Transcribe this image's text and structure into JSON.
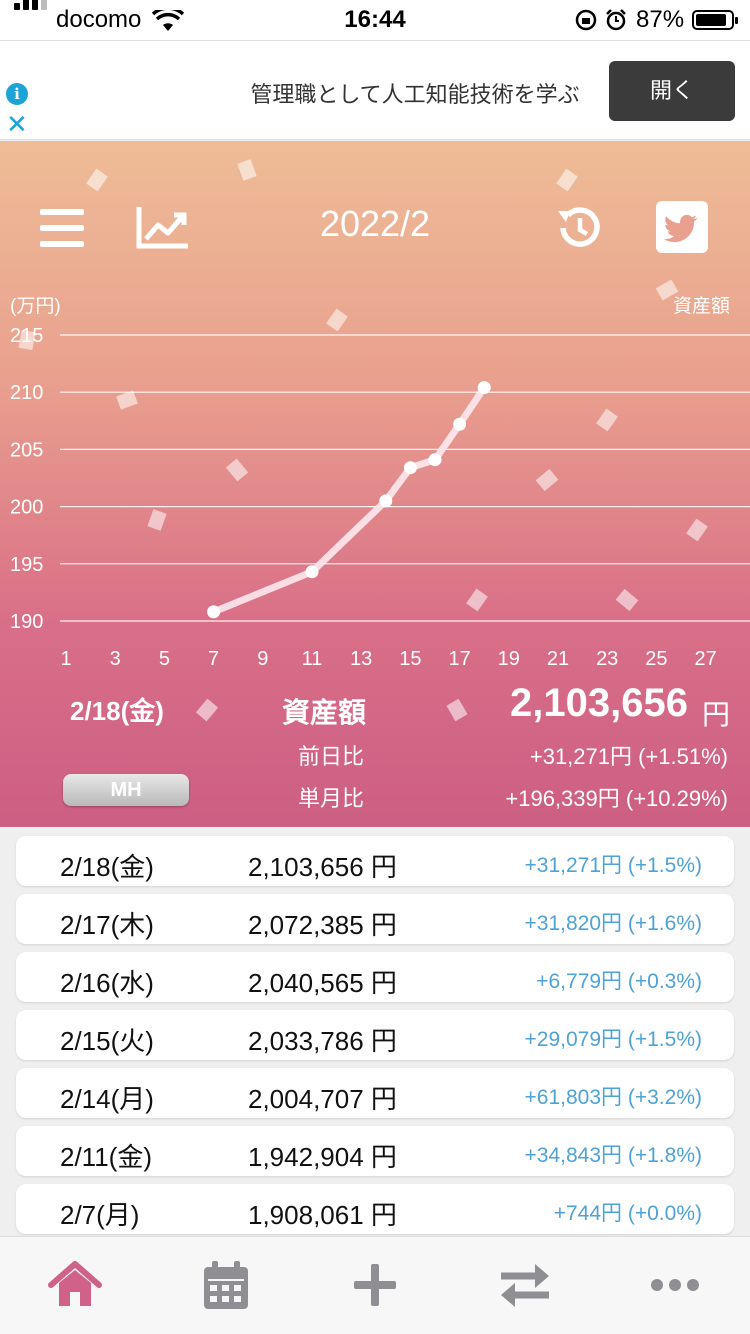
{
  "status_bar": {
    "carrier": "docomo",
    "time": "16:44",
    "battery": "87%"
  },
  "ad": {
    "text": "管理職として人工知能技術を学ぶ",
    "button": "開く"
  },
  "header": {
    "title": "2022/2",
    "y_unit": "(万円)",
    "series_label": "資産額",
    "selected_date": "2/18(金)",
    "asset_label": "資産額",
    "asset_value": "2,103,656",
    "asset_unit": "円",
    "prev_day_label": "前日比",
    "prev_day_value": "+31,271円 (+1.51%)",
    "month_label": "単月比",
    "month_value": "+196,339円 (+10.29%)",
    "mh_label": "MH"
  },
  "chart_data": {
    "type": "line",
    "title": "",
    "xlabel": "",
    "ylabel": "(万円)",
    "x_ticks": [
      "1",
      "3",
      "5",
      "7",
      "9",
      "11",
      "13",
      "15",
      "17",
      "19",
      "21",
      "23",
      "25",
      "27"
    ],
    "y_ticks": [
      "215",
      "210",
      "205",
      "200",
      "195",
      "190"
    ],
    "xlim": [
      1,
      28
    ],
    "ylim": [
      190,
      215
    ],
    "series": [
      {
        "name": "資産額",
        "x": [
          7,
          11,
          14,
          15,
          16,
          17,
          18
        ],
        "y": [
          190.8,
          194.3,
          200.5,
          203.4,
          204.1,
          207.2,
          210.4
        ]
      }
    ],
    "colors": {
      "line": "#fde9ee",
      "marker": "#ffffff",
      "grid": "#ffffff"
    }
  },
  "list": [
    {
      "date": "2/18(金)",
      "amount": "2,103,656 円",
      "change": "+31,271円 (+1.5%)"
    },
    {
      "date": "2/17(木)",
      "amount": "2,072,385 円",
      "change": "+31,820円 (+1.6%)"
    },
    {
      "date": "2/16(水)",
      "amount": "2,040,565 円",
      "change": "+6,779円 (+0.3%)"
    },
    {
      "date": "2/15(火)",
      "amount": "2,033,786 円",
      "change": "+29,079円 (+1.5%)"
    },
    {
      "date": "2/14(月)",
      "amount": "2,004,707 円",
      "change": "+61,803円 (+3.2%)"
    },
    {
      "date": "2/11(金)",
      "amount": "1,942,904 円",
      "change": "+34,843円 (+1.8%)"
    },
    {
      "date": "2/7(月)",
      "amount": "1,908,061 円",
      "change": "+744円 (+0.0%)"
    }
  ],
  "tabs": [
    {
      "icon": "home-icon",
      "active": true
    },
    {
      "icon": "calendar-icon",
      "active": false
    },
    {
      "icon": "plus-icon",
      "active": false
    },
    {
      "icon": "transfer-icon",
      "active": false
    },
    {
      "icon": "more-icon",
      "active": false
    }
  ],
  "colors": {
    "accent": "#d0628a",
    "inactive": "#8e8e93",
    "change_text": "#4ea2d6"
  }
}
